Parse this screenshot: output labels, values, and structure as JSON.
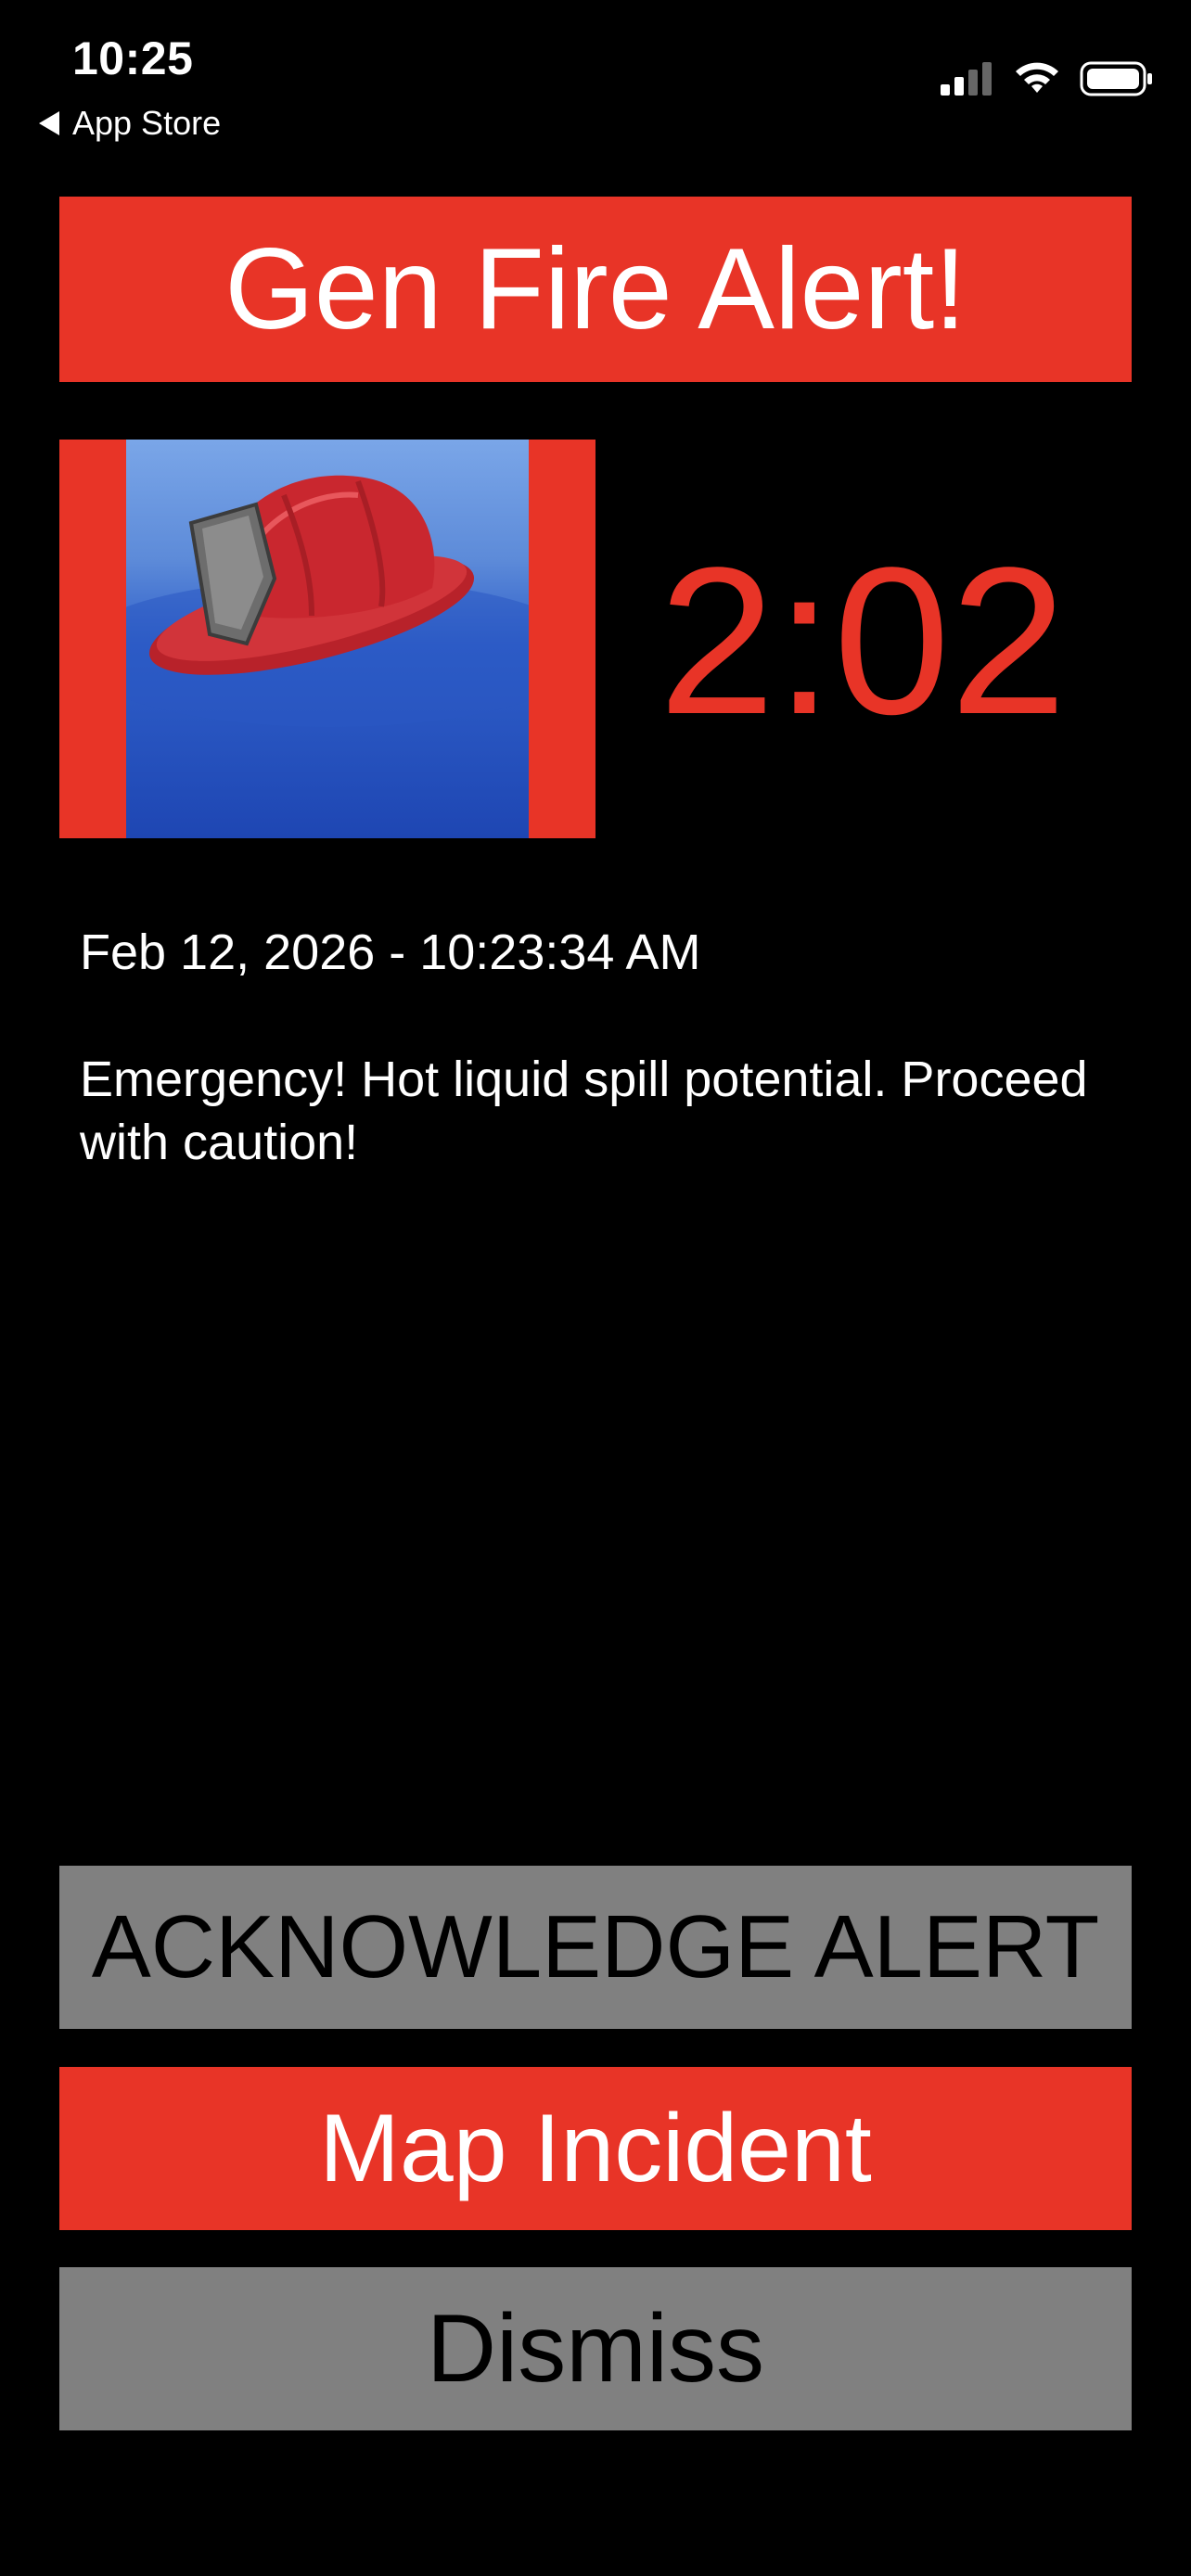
{
  "status_bar": {
    "time": "10:25",
    "back_label": "App Store",
    "signal_icon": "cellular-signal-icon",
    "wifi_icon": "wifi-icon",
    "battery_icon": "battery-icon"
  },
  "alert": {
    "title": "Gen Fire Alert!",
    "image_icon": "fire-helmet-icon",
    "timer": "2:02",
    "timestamp": "Feb 12, 2026 - 10:23:34 AM",
    "message": "Emergency! Hot liquid spill potential. Proceed with caution!"
  },
  "actions": {
    "acknowledge_label": "ACKNOWLEDGE ALERT",
    "map_label": "Map Incident",
    "dismiss_label": "Dismiss"
  },
  "colors": {
    "accent_red": "#e83427",
    "button_gray": "#808080",
    "background": "#000000"
  }
}
